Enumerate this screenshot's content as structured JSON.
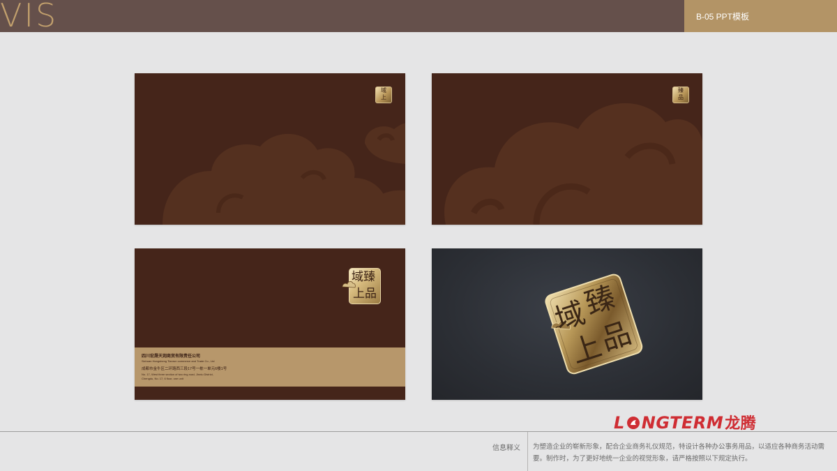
{
  "header": {
    "title": "VIS",
    "section_code": "B-05 PPT模板"
  },
  "mockups": {
    "logo": {
      "char_1": "域",
      "char_2": "臻",
      "char_3": "上",
      "char_4": "品"
    },
    "back_card": {
      "company_cn": "四川宏晟天润商贸有限责任公司",
      "company_en": "Sichuan Hongsheng Tianrun commerce and Trade Co., Ltd",
      "address_cn": "成都市金牛区二环路西三段17号一栋一单元6楼1号",
      "address_en_1": "No. 17, West three section of two ring road, Jinniu District,",
      "address_en_2": "Chengdu, No. 17, 6 floor, one unit"
    }
  },
  "footer": {
    "info_label": "信息释义",
    "info_line_1": "为塑造企业的崭新形象，配合企业商务礼仪规范，特设计各种办公事务用品，以适应各种商务活动需",
    "info_line_2": "要。制作时，为了更好地统一企业的视觉形象，请严格按照以下规定执行。",
    "brand_latin_1": "L",
    "brand_latin_2": "NGTERM",
    "brand_cn": "龙腾"
  },
  "colors": {
    "header_bg": "#65504b",
    "gold": "#b39466",
    "card_brown": "#45251a",
    "brand_red": "#cf2d33"
  }
}
